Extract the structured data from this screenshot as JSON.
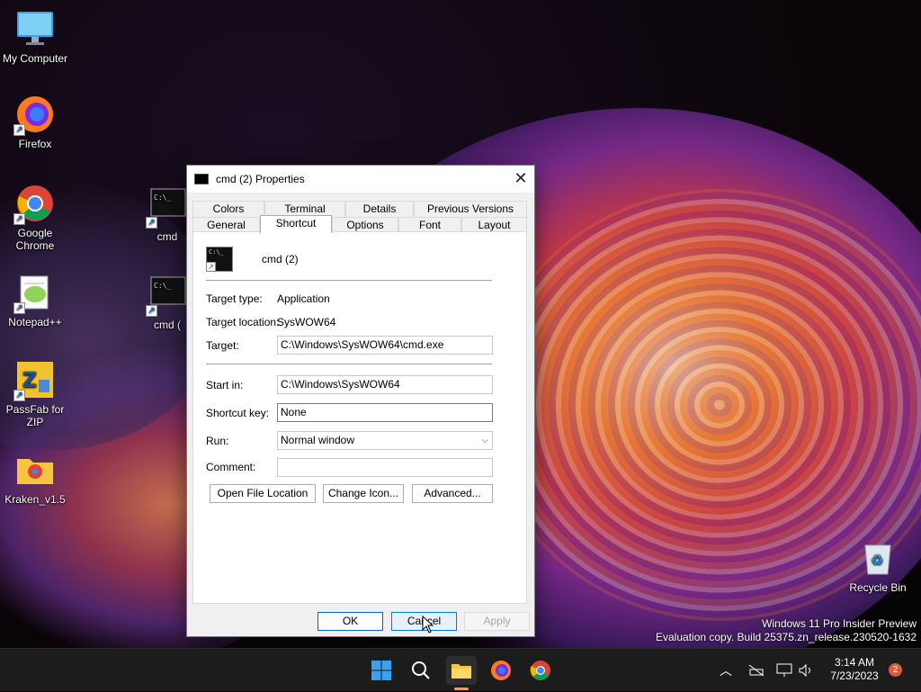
{
  "desktop": {
    "icons": [
      {
        "label": "My Computer"
      },
      {
        "label": "Firefox"
      },
      {
        "label": "Google Chrome"
      },
      {
        "label": "Notepad++"
      },
      {
        "label": "PassFab for ZIP"
      },
      {
        "label": "Kraken_v1.5"
      },
      {
        "label": "cmd"
      },
      {
        "label": "cmd ("
      },
      {
        "label": "Recycle Bin"
      }
    ],
    "watermark_line1": "Windows 11 Pro Insider Preview",
    "watermark_line2": "Evaluation copy. Build 25375.zn_release.230520-1632"
  },
  "dialog": {
    "title": "cmd (2) Properties",
    "tabs_row1": [
      "Colors",
      "Terminal",
      "Details",
      "Previous Versions"
    ],
    "tabs_row2": [
      "General",
      "Shortcut",
      "Options",
      "Font",
      "Layout"
    ],
    "active_tab": "Shortcut",
    "shortcut_name": "cmd (2)",
    "target_type_label": "Target type:",
    "target_type_value": "Application",
    "target_location_label": "Target location:",
    "target_location_value": "SysWOW64",
    "target_label": "Target:",
    "target_value": "C:\\Windows\\SysWOW64\\cmd.exe",
    "start_in_label": "Start in:",
    "start_in_value": "C:\\Windows\\SysWOW64",
    "shortcut_key_label": "Shortcut key:",
    "shortcut_key_value": "None",
    "run_label": "Run:",
    "run_value": "Normal window",
    "comment_label": "Comment:",
    "comment_value": "",
    "open_file_location": "Open File Location",
    "change_icon": "Change Icon...",
    "advanced": "Advanced...",
    "ok": "OK",
    "cancel": "Cancel",
    "apply": "Apply"
  },
  "taskbar": {
    "time": "3:14 AM",
    "date": "7/23/2023",
    "notification_count": "2"
  },
  "colors": {
    "accent": "#0067c0",
    "taskbar": "#1c1c1c",
    "notification_badge": "#e05a3a"
  }
}
